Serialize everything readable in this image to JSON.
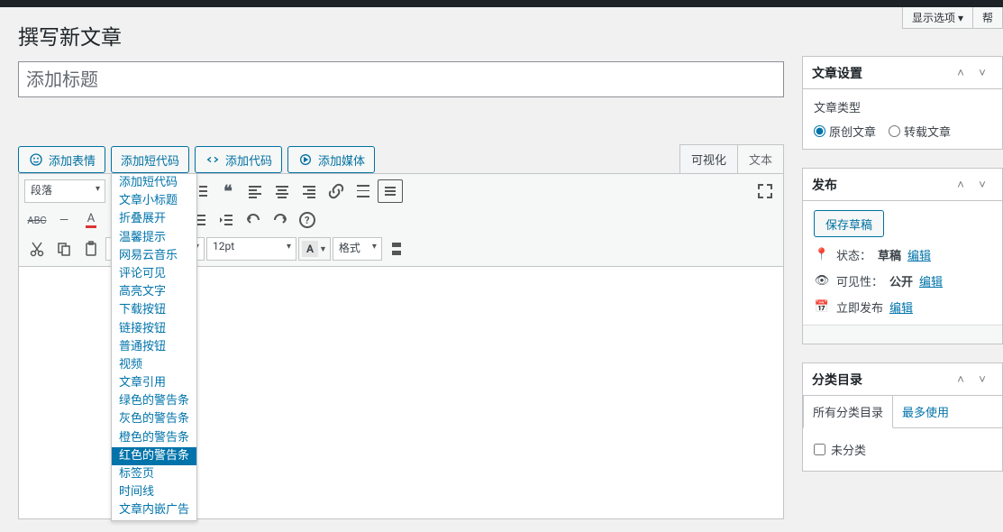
{
  "screen_options": {
    "label": "显示选项",
    "help": "帮"
  },
  "page_title": "撰写新文章",
  "title_placeholder": "添加标题",
  "buttons": {
    "emoji": "添加表情",
    "shortcode": "添加短代码",
    "code": "添加代码",
    "media": "添加媒体"
  },
  "shortcode_menu": [
    "添加短代码",
    "文章小标题",
    "折叠展开",
    "温馨提示",
    "网易云音乐",
    "评论可见",
    "高亮文字",
    "下载按钮",
    "链接按钮",
    "普通按钮",
    "视频",
    "文章引用",
    "绿色的警告条",
    "灰色的警告条",
    "橙色的警告条",
    "红色的警告条",
    "标签页",
    "时间线",
    "文章内嵌广告"
  ],
  "shortcode_menu_highlight": 15,
  "editor_tabs": {
    "visual": "可视化",
    "text": "文本"
  },
  "toolbar": {
    "para_select": "段落",
    "font_select": "",
    "size_select": "12pt",
    "format_select": "格式",
    "color_letter": "A"
  },
  "sidebar": {
    "settings": {
      "title": "文章设置",
      "type_label": "文章类型",
      "type_original": "原创文章",
      "type_repost": "转载文章"
    },
    "publish": {
      "title": "发布",
      "save_draft": "保存草稿",
      "status_label": "状态：",
      "status_value": "草稿",
      "visibility_label": "可见性：",
      "visibility_value": "公开",
      "schedule_label": "立即发布",
      "edit": "编辑"
    },
    "categories": {
      "title": "分类目录",
      "all_tab": "所有分类目录",
      "most_used_tab": "最多使用",
      "uncategorized": "未分类"
    }
  }
}
